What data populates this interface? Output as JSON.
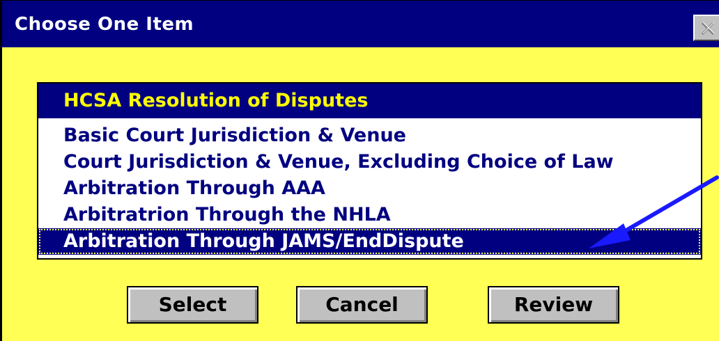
{
  "window": {
    "title": "Choose One Item",
    "close_icon": "close-icon"
  },
  "listbox": {
    "header": "HCSA Resolution of Disputes",
    "items": [
      {
        "label": "Basic Court Jurisdiction & Venue",
        "selected": false
      },
      {
        "label": "Court Jurisdiction & Venue, Excluding Choice of Law",
        "selected": false
      },
      {
        "label": "Arbitration Through AAA",
        "selected": false
      },
      {
        "label": "Arbitratrion Through the NHLA",
        "selected": false
      },
      {
        "label": "Arbitration Through JAMS/EndDispute",
        "selected": true
      }
    ]
  },
  "annotation": {
    "arrow_icon": "arrow-icon",
    "arrow_color": "#1a1aff"
  },
  "buttons": {
    "select_label": "Select",
    "cancel_label": "Cancel",
    "review_label": "Review"
  },
  "colors": {
    "titlebar": "#000080",
    "dialog_background": "#ffff55",
    "header_text": "#ffff00",
    "item_text": "#000080",
    "button_face": "#c0c0c0"
  }
}
